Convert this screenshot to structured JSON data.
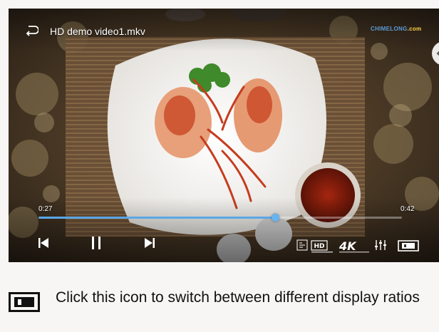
{
  "player": {
    "title": "HD demo video1.mkv",
    "watermark": {
      "brand": "CHIMELONG",
      "suffix": ".com"
    },
    "time_elapsed": "0:27",
    "time_total": "0:42",
    "progress": 0.65,
    "badge_hd": "HD",
    "badge_4k": "4K",
    "colors": {
      "progress": "#5aa7e6",
      "watermark": "#5b9bd5"
    }
  },
  "caption": {
    "text": "Click this icon to switch between different display ratios"
  }
}
